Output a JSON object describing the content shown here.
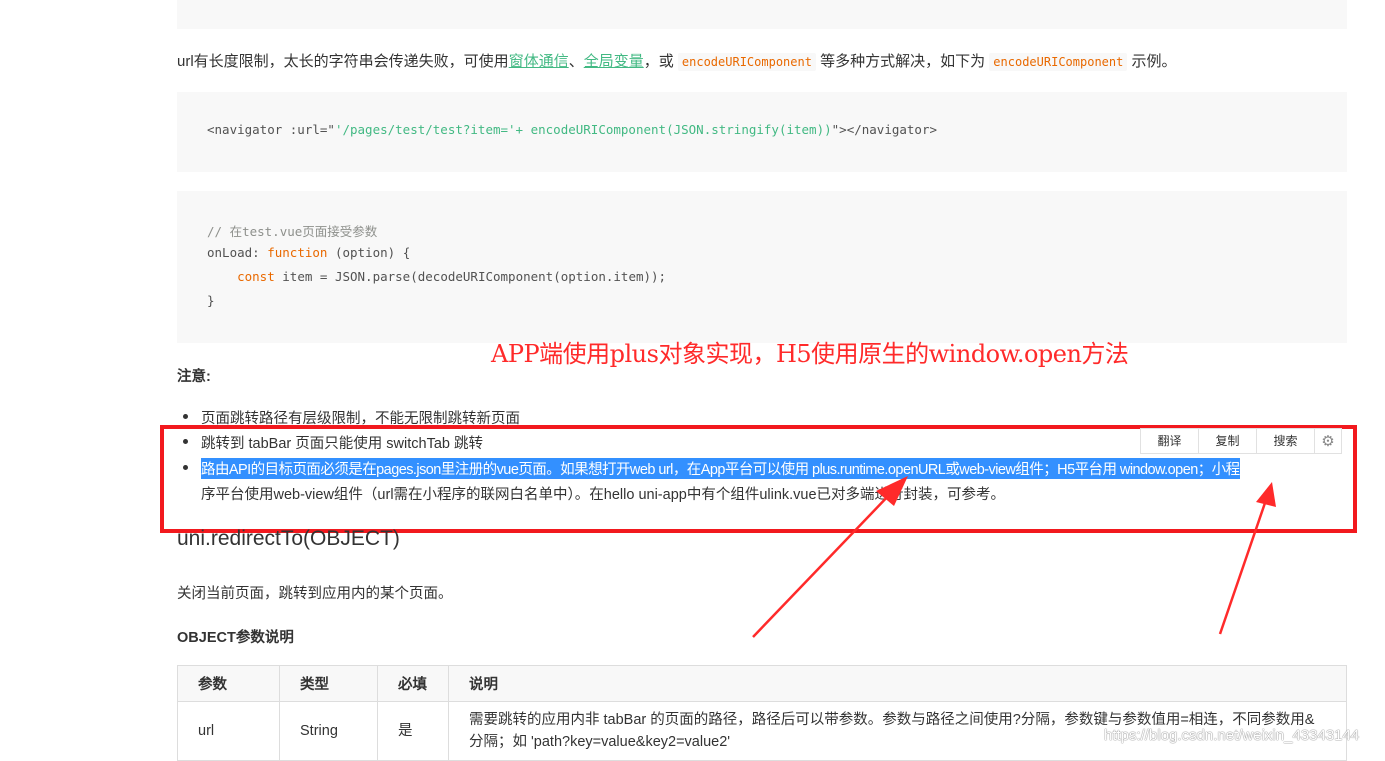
{
  "intro": {
    "before": "url有长度限制，太长的字符串会传递失败，可使用",
    "link1": "窗体通信",
    "sep1": "、",
    "link2": "全局变量",
    "mid": "，或 ",
    "code1": "encodeURIComponent",
    "mid2": " 等多种方式解决，如下为 ",
    "code2": "encodeURIComponent",
    "after": " 示例。"
  },
  "code1": {
    "line_pre": "<navigator :url=\"",
    "line_str": "'/pages/test/test?item='+ encodeURIComponent(JSON.stringify(item))",
    "line_post": "\"></navigator>"
  },
  "code2": {
    "comment": "// 在test.vue页面接受参数",
    "l2_a": "onLoad: ",
    "l2_kw": "function",
    "l2_b": " (option) {",
    "l3_indent": "    ",
    "l3_kw": "const",
    "l3_b": " item = JSON.parse(decodeURIComponent(option.item));",
    "l4": "}"
  },
  "annotation": "APP端使用plus对象实现，H5使用原生的window.open方法",
  "note_title": "注意:",
  "bullets": [
    "页面跳转路径有层级限制，不能无限制跳转新页面",
    "跳转到 tabBar 页面只能使用 switchTab 跳转"
  ],
  "bullet3": {
    "selected": "路由API的目标页面必须是在pages.json里注册的vue页面。如果想打开web url，在App平台可以使用 plus.runtime.openURL或web-view组件；H5平台用 window.open；小程",
    "rest": "序平台使用web-view组件（url需在小程序的联网白名单中）。在hello uni-app中有个组件ulink.vue已对多端进行封装，可参考。"
  },
  "toolbar": {
    "translate": "翻译",
    "copy": "复制",
    "search": "搜索",
    "settings_icon": "gear-icon"
  },
  "heading": "uni.redirectTo(OBJECT)",
  "desc": "关闭当前页面，跳转到应用内的某个页面。",
  "object_title": "OBJECT参数说明",
  "table": {
    "headers": [
      "参数",
      "类型",
      "必填",
      "说明"
    ],
    "rows": [
      [
        "url",
        "String",
        "是",
        "需要跳转的应用内非 tabBar 的页面的路径，路径后可以带参数。参数与路径之间使用?分隔，参数键与参数值用=相连，不同参数用&分隔；如 'path?key=value&key2=value2'"
      ]
    ]
  },
  "watermark": "https://blog.csdn.net/weixin_43343144",
  "colors": {
    "accent": "#42b983",
    "code_kw": "#e96900",
    "annotation_red": "#ff2a2a",
    "selection": "#3390ff"
  }
}
